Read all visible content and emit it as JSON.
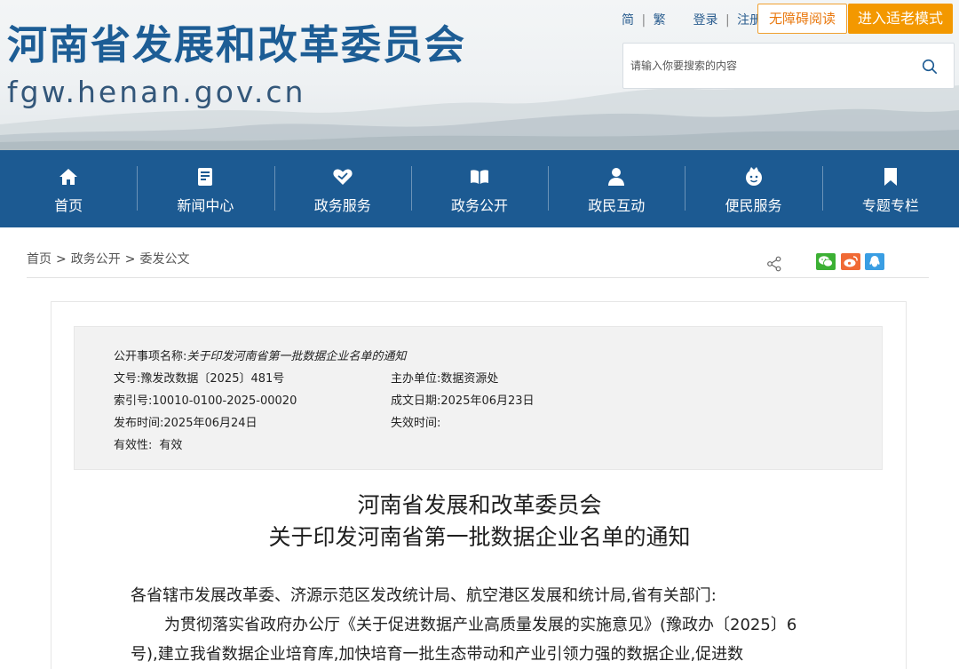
{
  "header": {
    "title": "河南省发展和改革委员会",
    "domain": "fgw.henan.gov.cn",
    "lang_simplified": "简",
    "lang_traditional": "繁",
    "login": "登录",
    "register": "注册",
    "accessible_btn": "无障碍阅读",
    "elder_btn": "进入适老模式",
    "search_placeholder": "请输入你要搜索的内容"
  },
  "nav": {
    "items": [
      {
        "label": "首页",
        "icon": "home-icon"
      },
      {
        "label": "新闻中心",
        "icon": "news-icon"
      },
      {
        "label": "政务服务",
        "icon": "service-icon"
      },
      {
        "label": "政务公开",
        "icon": "book-icon"
      },
      {
        "label": "政民互动",
        "icon": "people-icon"
      },
      {
        "label": "便民服务",
        "icon": "convenience-icon"
      },
      {
        "label": "专题专栏",
        "icon": "bookmark-icon"
      }
    ]
  },
  "breadcrumb": {
    "home": "首页",
    "section": "政务公开",
    "current": "委发公文",
    "separator": ">"
  },
  "meta": {
    "item_name_label": "公开事项名称:",
    "item_name_value": "关于印发河南省第一批数据企业名单的通知",
    "doc_no_label": "文号:",
    "doc_no_value": "豫发改数据〔2025〕481号",
    "host_label": "主办单位:",
    "host_value": "数据资源处",
    "index_label": "索引号:",
    "index_value": "10010-0100-2025-00020",
    "created_label": "成文日期:",
    "created_value": "2025年06月23日",
    "publish_label": "发布时间:",
    "publish_value": "2025年06月24日",
    "expire_label": "失效时间:",
    "expire_value": "",
    "validity_label": "有效性:",
    "validity_value": "有效"
  },
  "document": {
    "title_line1": "河南省发展和改革委员会",
    "title_line2": "关于印发河南省第一批数据企业名单的通知",
    "salutation": "各省辖市发展改革委、济源示范区发改统计局、航空港区发展和统计局,省有关部门:",
    "body_line1": "为贯彻落实省政府办公厅《关于促进数据产业高质量发展的实施意见》(豫政办〔2025〕6",
    "body_line2": "号),建立我省数据企业培育库,加快培育一批生态带动和产业引领力强的数据企业,促进数"
  },
  "colors": {
    "primary": "#1c5a92",
    "accent": "#f39800",
    "title_blue": "#1d5d95"
  }
}
